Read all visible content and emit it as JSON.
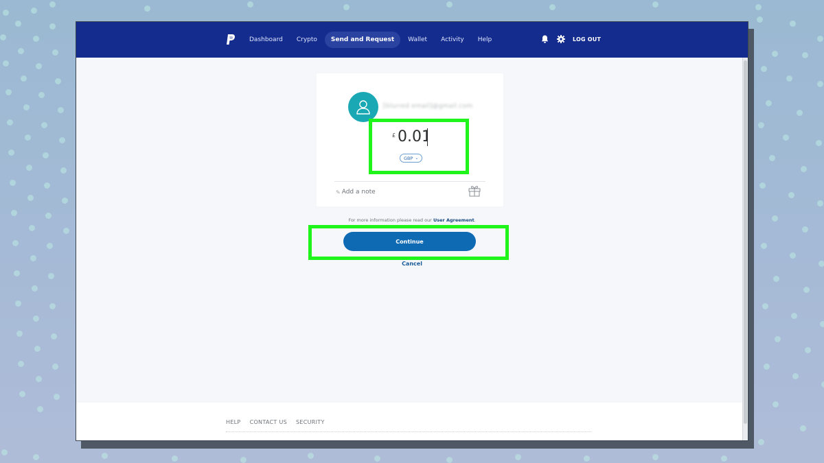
{
  "colors": {
    "nav_bg": "#142c8e",
    "accent_blue": "#0f6ab4",
    "avatar_teal": "#1ba8b5",
    "highlight_green": "#1ff51a"
  },
  "nav": {
    "logo_icon": "paypal-logo-icon",
    "items": [
      {
        "label": "Dashboard",
        "active": false
      },
      {
        "label": "Crypto",
        "active": false
      },
      {
        "label": "Send and Request",
        "active": true
      },
      {
        "label": "Wallet",
        "active": false
      },
      {
        "label": "Activity",
        "active": false
      },
      {
        "label": "Help",
        "active": false
      }
    ],
    "notification_icon": "bell-icon",
    "settings_icon": "gear-icon",
    "logout_label": "LOG OUT"
  },
  "payment": {
    "recipient_icon": "user-icon",
    "recipient_email": "[blurred email]@gmail.com",
    "currency_symbol": "£",
    "amount": "0.01",
    "currency_code": "GBP",
    "note_label": "Add a note",
    "note_icon": "pencil-icon",
    "gift_icon": "gift-icon"
  },
  "agreement": {
    "text": "For more information please read our ",
    "link_label": "User Agreement",
    "suffix": "."
  },
  "actions": {
    "continue_label": "Continue",
    "cancel_label": "Cancel"
  },
  "footer": {
    "links": [
      "HELP",
      "CONTACT US",
      "SECURITY"
    ]
  }
}
